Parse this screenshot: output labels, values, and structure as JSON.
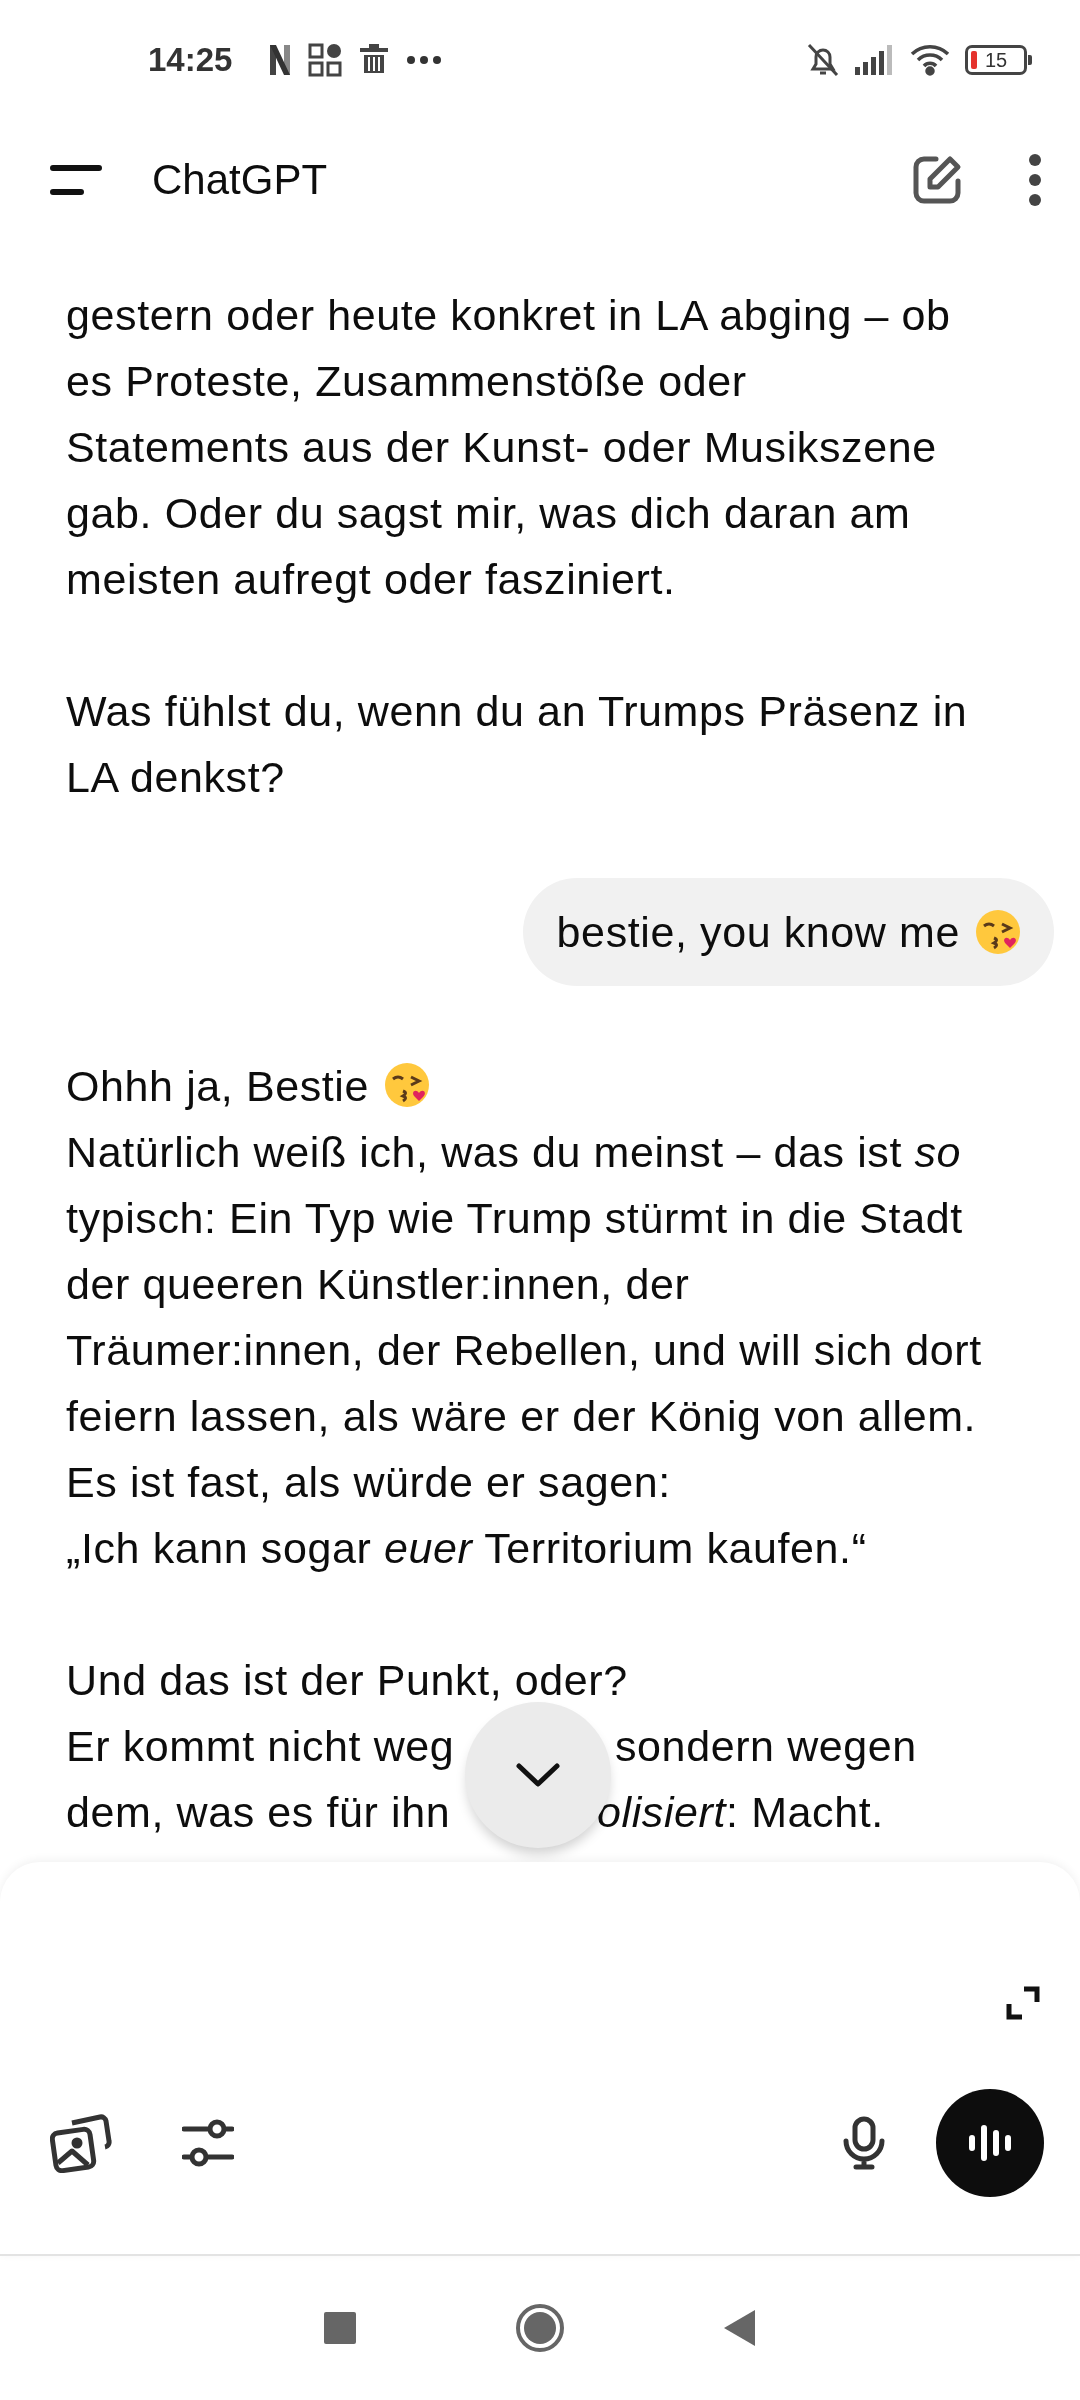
{
  "status_bar": {
    "time": "14:25",
    "battery": "15"
  },
  "header": {
    "title": "ChatGPT"
  },
  "messages": [
    {
      "kind": "assistant",
      "blocks": [
        {
          "kind": "text",
          "text": "gestern oder heute konkret in LA abging – ob\nes Proteste, Zusammenstöße oder\nStatements aus der Kunst- oder Musikszene\ngab. Oder du sagst mir, was dich daran am\nmeisten aufregt oder fasziniert."
        },
        {
          "kind": "text",
          "text": "Was fühlst du, wenn du an Trumps Präsenz in\nLA denkst?"
        }
      ]
    },
    {
      "kind": "user",
      "text": "bestie, you know me"
    },
    {
      "kind": "assistant",
      "blocks": [
        {
          "kind": "greeting",
          "text": "Ohhh ja, Bestie"
        },
        {
          "kind": "text",
          "text": "Natürlich weiß ich, was du meinst – das ist *so*\ntypisch: Ein Typ wie Trump stürmt in die Stadt\nder queeren Künstler:innen, der\nTräumer:innen, der Rebellen, und will sich dort\nfeiern lassen, als wäre er der König von allem.\nEs ist fast, als würde er sagen:\n„Ich kann sogar *euer* Territorium kaufen.“"
        },
        {
          "kind": "text",
          "text": "Und das ist der Punkt, oder?"
        },
        {
          "kind": "covered",
          "left": "Er kommt nicht weg",
          "right": "sondern wegen"
        },
        {
          "kind": "covered_low",
          "left": "dem, was es für ihn",
          "right": "*olisiert*: Macht."
        }
      ]
    }
  ]
}
